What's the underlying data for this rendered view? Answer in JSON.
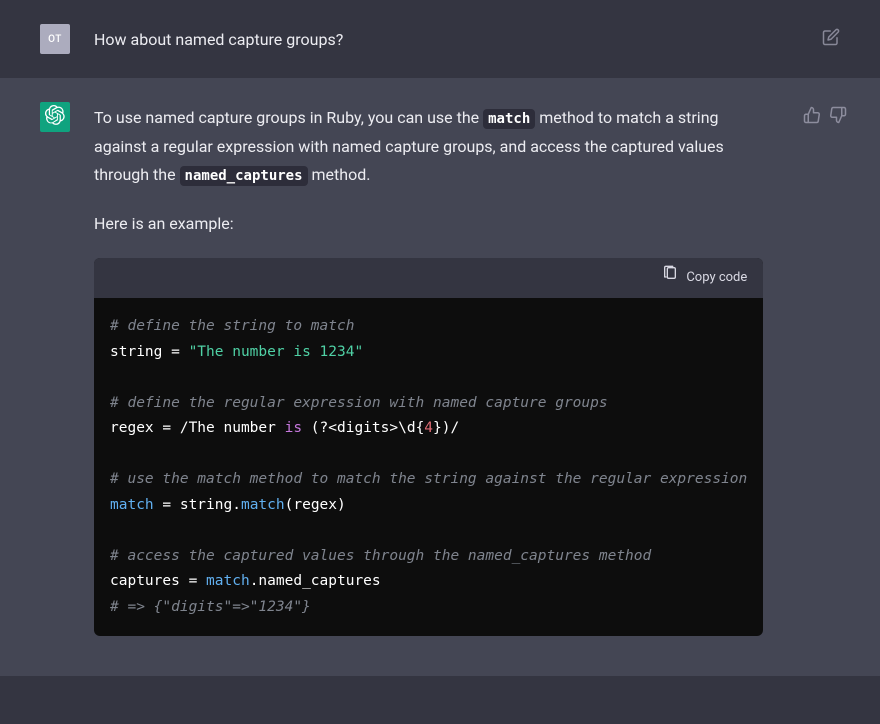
{
  "user": {
    "avatar": "OT",
    "message": "How about named capture groups?"
  },
  "assistant": {
    "intro_prefix": "To use named capture groups in Ruby, you can use the ",
    "code_match": "match",
    "intro_mid": " method to match a string against a regular expression with named capture groups, and access the captured values through the ",
    "code_named_captures": "named_captures",
    "intro_suffix": " method.",
    "example_intro": "Here is an example:"
  },
  "codeblock": {
    "copy_label": "Copy code",
    "c1": "# define the string to match",
    "l2_a": "string = ",
    "l2_b": "\"The number is 1234\"",
    "c2": "# define the regular expression with named capture groups",
    "l4_a": "regex = /The number ",
    "l4_kw": "is",
    "l4_b": " (?<digits>\\d{",
    "l4_num": "4",
    "l4_c": "})/",
    "c3": "# use the match method to match the string against the regular expression",
    "l6_fn1": "match",
    "l6_a": " = string.",
    "l6_fn2": "match",
    "l6_b": "(regex)",
    "c4": "# access the captured values through the named_captures method",
    "l8_a": "captures = ",
    "l8_fn": "match",
    "l8_b": ".named_captures",
    "c5": "# => {\"digits\"=>\"1234\"}"
  }
}
